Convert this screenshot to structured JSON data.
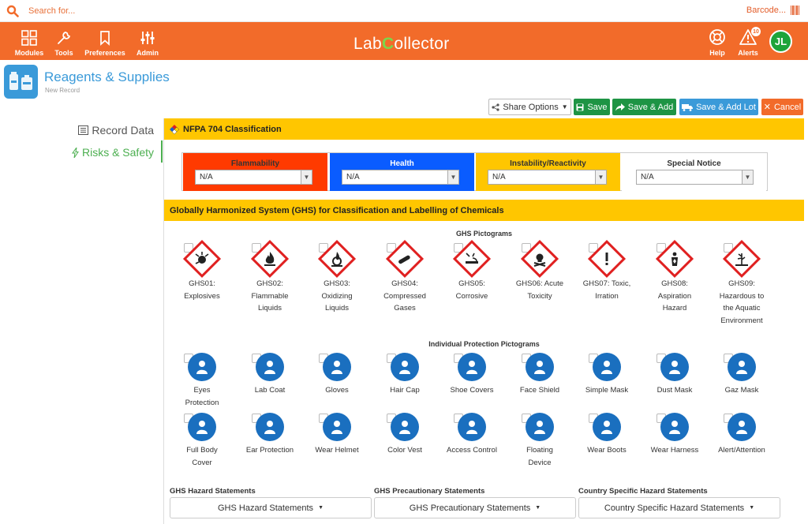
{
  "search": {
    "placeholder": "Search for..."
  },
  "barcode": {
    "label": "Barcode..."
  },
  "nav": {
    "modules": "Modules",
    "tools": "Tools",
    "preferences": "Preferences",
    "admin": "Admin",
    "help": "Help",
    "alerts": "Alerts",
    "alerts_count": "10",
    "logo_left": "Lab",
    "logo_c": "C",
    "logo_right": "ollector",
    "avatar_initials": "JL"
  },
  "module": {
    "title": "Reagents & Supplies",
    "subtitle": "New Record"
  },
  "toolbar": {
    "share": "Share Options",
    "save": "Save",
    "save_add": "Save & Add",
    "save_add_lot": "Save & Add Lot",
    "cancel": "Cancel"
  },
  "sidebar": {
    "record_data": "Record Data",
    "risks_safety": "Risks & Safety"
  },
  "nfpa": {
    "header": "NFPA 704 Classification",
    "boxes": [
      {
        "label": "Flammability",
        "value": "N/A",
        "color": "#ff3a00"
      },
      {
        "label": "Health",
        "value": "N/A",
        "color": "#0a5cff"
      },
      {
        "label": "Instability/Reactivity",
        "value": "N/A",
        "color": "#ffc600"
      },
      {
        "label": "Special Notice",
        "value": "N/A",
        "color": "#ffffff"
      }
    ]
  },
  "ghs": {
    "header": "Globally Harmonized System (GHS) for Classification and Labelling of Chemicals",
    "pictograms_title": "GHS Pictograms",
    "pictograms": [
      {
        "icon": "explosive-icon",
        "line1": "GHS01:",
        "line2": "Explosives",
        "line3": "",
        "line4": ""
      },
      {
        "icon": "flame-icon",
        "line1": "GHS02:",
        "line2": "Flammable",
        "line3": "Liquids",
        "line4": ""
      },
      {
        "icon": "flame-over-circle-icon",
        "line1": "GHS03:",
        "line2": "Oxidizing",
        "line3": "Liquids",
        "line4": ""
      },
      {
        "icon": "gas-cylinder-icon",
        "line1": "GHS04:",
        "line2": "Compressed",
        "line3": "Gases",
        "line4": ""
      },
      {
        "icon": "corrosion-icon",
        "line1": "GHS05:",
        "line2": "Corrosive",
        "line3": "",
        "line4": ""
      },
      {
        "icon": "skull-icon",
        "line1": "GHS06: Acute",
        "line2": "Toxicity",
        "line3": "",
        "line4": ""
      },
      {
        "icon": "exclamation-icon",
        "line1": "GHS07: Toxic,",
        "line2": "Irration",
        "line3": "",
        "line4": ""
      },
      {
        "icon": "health-hazard-icon",
        "line1": "GHS08:",
        "line2": "Aspiration",
        "line3": "Hazard",
        "line4": ""
      },
      {
        "icon": "environment-icon",
        "line1": "GHS09:",
        "line2": "Hazardous to",
        "line3": "the Aquatic",
        "line4": "Environment"
      }
    ],
    "protection_title": "Individual Protection Pictograms",
    "protection_row1": [
      {
        "icon": "goggles-icon",
        "line1": "Eyes",
        "line2": "Protection"
      },
      {
        "icon": "lab-coat-icon",
        "line1": "Lab Coat",
        "line2": ""
      },
      {
        "icon": "gloves-icon",
        "line1": "Gloves",
        "line2": ""
      },
      {
        "icon": "hair-cap-icon",
        "line1": "Hair Cap",
        "line2": ""
      },
      {
        "icon": "shoe-covers-icon",
        "line1": "Shoe Covers",
        "line2": ""
      },
      {
        "icon": "face-shield-icon",
        "line1": "Face Shield",
        "line2": ""
      },
      {
        "icon": "simple-mask-icon",
        "line1": "Simple Mask",
        "line2": ""
      },
      {
        "icon": "dust-mask-icon",
        "line1": "Dust Mask",
        "line2": ""
      },
      {
        "icon": "gas-mask-icon",
        "line1": "Gaz Mask",
        "line2": ""
      }
    ],
    "protection_row2": [
      {
        "icon": "full-body-icon",
        "line1": "Full Body",
        "line2": "Cover"
      },
      {
        "icon": "ear-protection-icon",
        "line1": "Ear Protection",
        "line2": ""
      },
      {
        "icon": "helmet-icon",
        "line1": "Wear Helmet",
        "line2": ""
      },
      {
        "icon": "vest-icon",
        "line1": "Color Vest",
        "line2": ""
      },
      {
        "icon": "access-control-icon",
        "line1": "Access Control",
        "line2": ""
      },
      {
        "icon": "floating-device-icon",
        "line1": "Floating",
        "line2": "Device"
      },
      {
        "icon": "boots-icon",
        "line1": "Wear Boots",
        "line2": ""
      },
      {
        "icon": "harness-icon",
        "line1": "Wear Harness",
        "line2": ""
      },
      {
        "icon": "alert-icon",
        "line1": "Alert/Attention",
        "line2": ""
      }
    ]
  },
  "statements": {
    "hazard_title": "GHS Hazard Statements",
    "hazard_button": "GHS Hazard Statements",
    "precautionary_title": "GHS Precautionary Statements",
    "precautionary_button": "GHS Precautionary Statements",
    "country_title": "Country Specific Hazard Statements",
    "country_button": "Country Specific Hazard Statements"
  }
}
